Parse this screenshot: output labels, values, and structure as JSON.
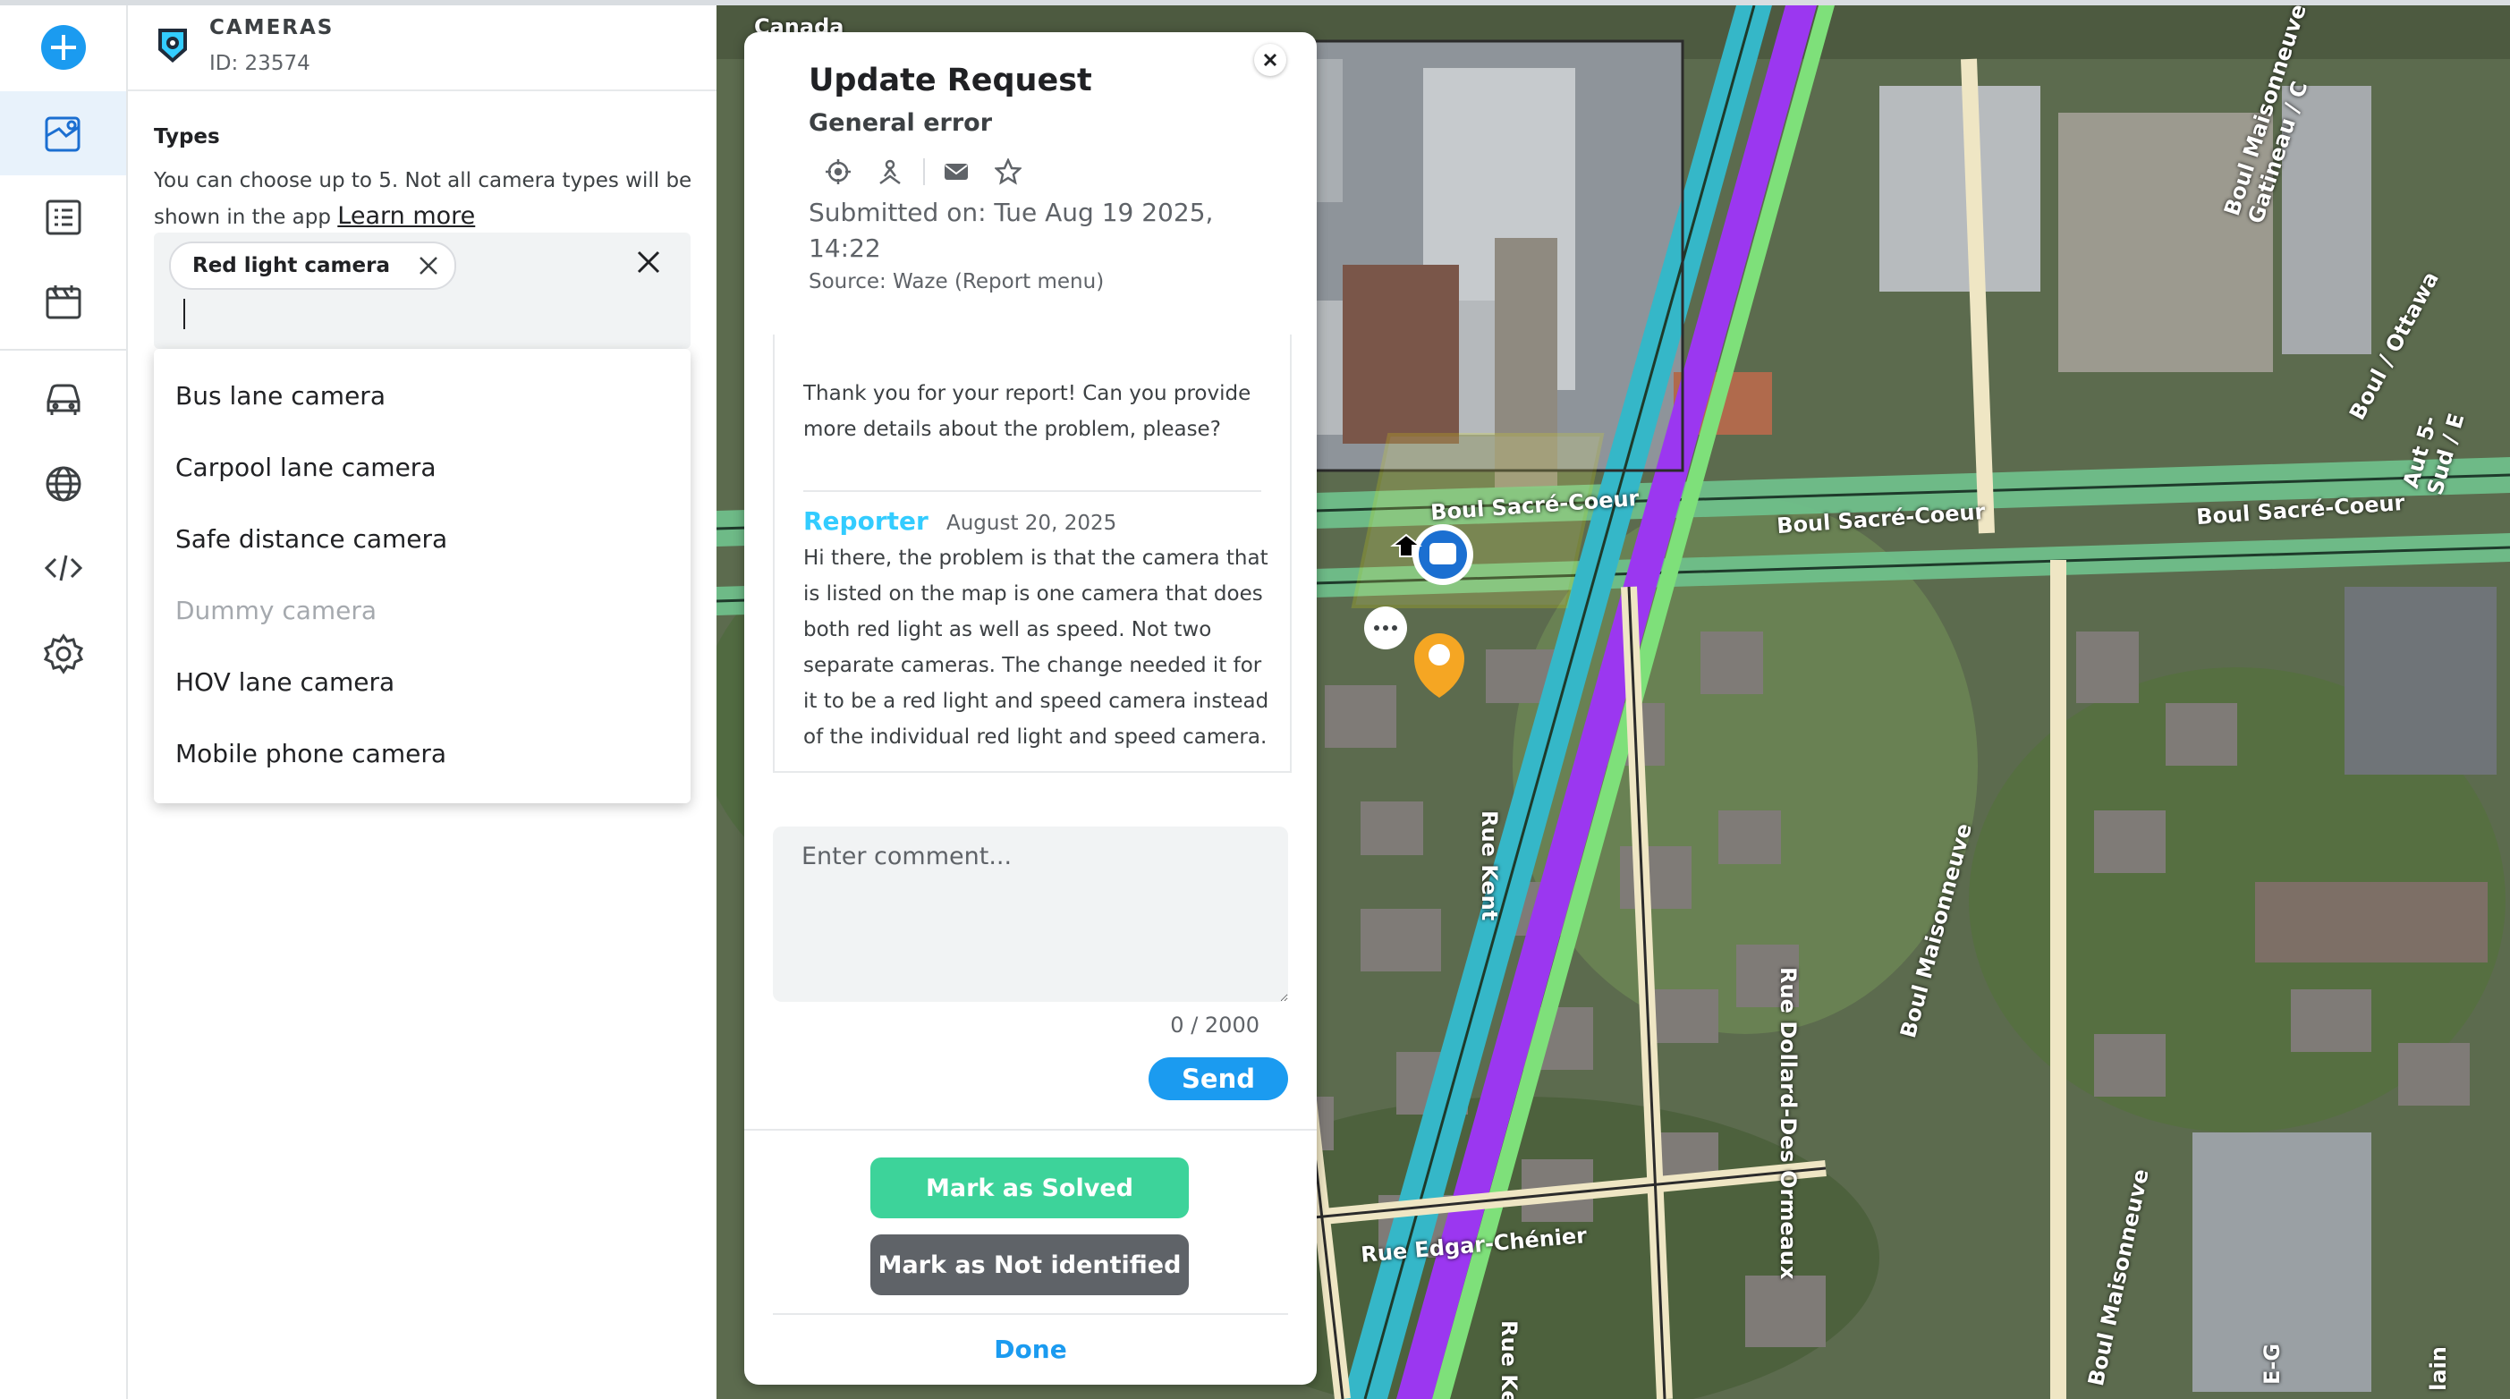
{
  "colors": {
    "accent": "#1b9bf0",
    "solved": "#3dd39a",
    "not_identified": "#5f6368",
    "reporter": "#33ccff"
  },
  "rail": {
    "items": [
      {
        "icon": "add-icon"
      },
      {
        "icon": "map-edit-icon"
      },
      {
        "icon": "list-icon"
      },
      {
        "icon": "calendar-icon"
      },
      {
        "icon": "car-icon"
      },
      {
        "icon": "globe-icon"
      },
      {
        "icon": "code-icon"
      },
      {
        "icon": "settings-icon"
      }
    ]
  },
  "panel": {
    "title": "CAMERAS",
    "id": "ID: 23574",
    "types_label": "Types",
    "types_help": "You can choose up to 5. Not all camera types will be shown in the app ",
    "learn_more": "Learn more",
    "selected_chip": "Red light camera",
    "dropdown": [
      {
        "label": "Bus lane camera",
        "disabled": false
      },
      {
        "label": "Carpool lane camera",
        "disabled": false
      },
      {
        "label": "Safe distance camera",
        "disabled": false
      },
      {
        "label": "Dummy camera",
        "disabled": true
      },
      {
        "label": "HOV lane camera",
        "disabled": false
      },
      {
        "label": "Mobile phone camera",
        "disabled": false
      }
    ]
  },
  "map": {
    "labels": {
      "country": "Canada",
      "sacre1": "Boul Sacré-Coeur",
      "sacre2": "Boul Sacré-Coeur",
      "sacre3": "Boul Sacré-Coeur",
      "maison_top": "Boul Maisonneuve / Gatineau / C",
      "ottawa": "Boul / Ottawa",
      "kent": "Rue Kent",
      "kent2": "Rue Kent",
      "dollard": "Rue Dollard-Des Ormeaux",
      "maison1": "Boul Maisonneuve",
      "maison2": "Boul Maisonneuve",
      "edgar": "Rue Edgar-Chénier",
      "aut": "Aut 5-Sud / E",
      "gc": "E-G",
      "lain": "lain"
    }
  },
  "dialog": {
    "title": "Update Request",
    "subtitle": "General error",
    "submitted": "Submitted on: Tue Aug 19 2025, 14:22",
    "source": "Source: Waze (Report menu)",
    "system_message": "Thank you for your report! Can you provide more details about the problem, please?",
    "reporter_name": "Reporter",
    "reporter_date": "August 20, 2025",
    "reporter_message": "Hi there, the problem is that the camera that is listed on the map is one camera that does both red light as well as speed. Not two separate cameras. The change needed it for it to be a red light and speed camera instead of the individual red light and speed camera.",
    "comment_placeholder": "Enter comment...",
    "counter": "0 / 2000",
    "send": "Send",
    "mark_solved": "Mark as Solved",
    "mark_not_identified": "Mark as Not identified",
    "done": "Done"
  }
}
